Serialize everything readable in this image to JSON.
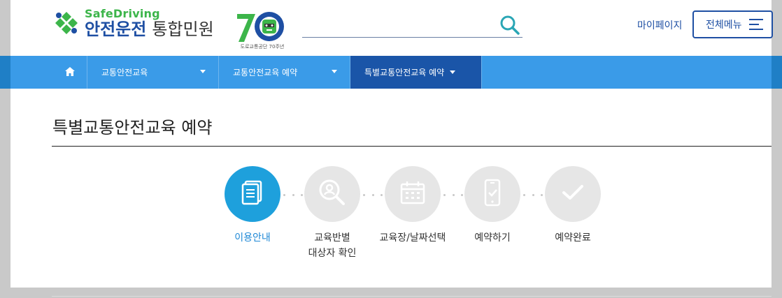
{
  "header": {
    "logo_sub": "SafeDriving",
    "logo_main": "안전운전",
    "logo_service": "통합민원",
    "anniversary_caption": "도로교통공단 70주년",
    "search": {
      "placeholder": "",
      "icon": "search-icon"
    },
    "mypage_label": "마이페이지",
    "allmenu_label": "전체메뉴"
  },
  "nav": {
    "home_icon": "home-icon",
    "items": [
      {
        "label": "교통안전교육"
      },
      {
        "label": "교통안전교육 예약"
      },
      {
        "label": "특별교통안전교육 예약"
      }
    ]
  },
  "page": {
    "title": "특별교통안전교육 예약"
  },
  "steps": [
    {
      "label": "이용안내",
      "icon": "document-icon",
      "active": true
    },
    {
      "label": "교육반별\n대상자 확인",
      "icon": "person-search-icon",
      "active": false
    },
    {
      "label": "교육장/날짜선택",
      "icon": "calendar-icon",
      "active": false
    },
    {
      "label": "예약하기",
      "icon": "mobile-check-icon",
      "active": false
    },
    {
      "label": "예약완료",
      "icon": "checkmark-icon",
      "active": false
    }
  ],
  "colors": {
    "brand_blue": "#1e4fa3",
    "nav_blue": "#3a9be8",
    "nav_active": "#1a55a8",
    "step_active": "#1ea0dc",
    "logo_green": "#3cb54a"
  }
}
